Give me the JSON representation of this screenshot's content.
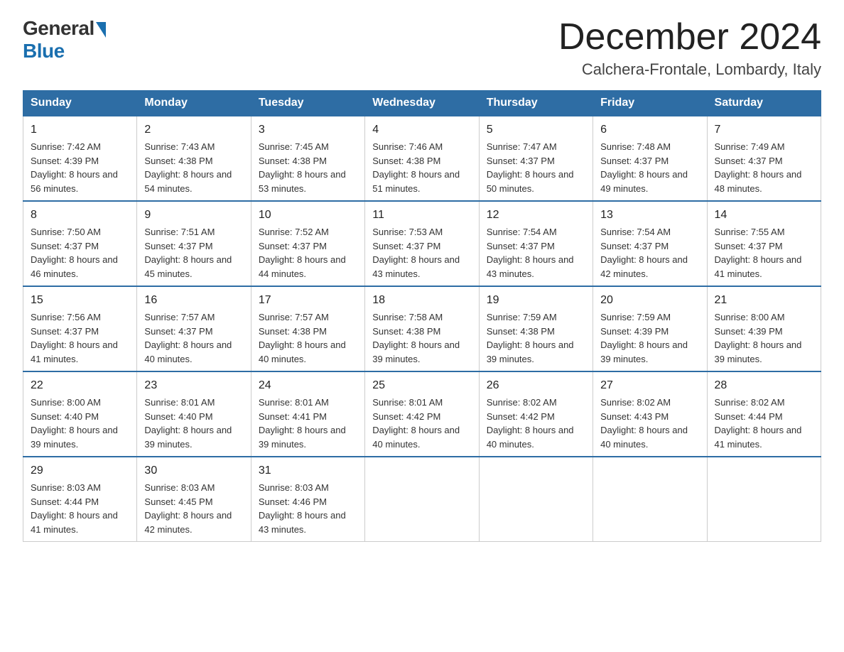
{
  "header": {
    "logo_general": "General",
    "logo_blue": "Blue",
    "title": "December 2024",
    "subtitle": "Calchera-Frontale, Lombardy, Italy"
  },
  "weekdays": [
    "Sunday",
    "Monday",
    "Tuesday",
    "Wednesday",
    "Thursday",
    "Friday",
    "Saturday"
  ],
  "weeks": [
    [
      {
        "day": "1",
        "sunrise": "7:42 AM",
        "sunset": "4:39 PM",
        "daylight": "8 hours and 56 minutes."
      },
      {
        "day": "2",
        "sunrise": "7:43 AM",
        "sunset": "4:38 PM",
        "daylight": "8 hours and 54 minutes."
      },
      {
        "day": "3",
        "sunrise": "7:45 AM",
        "sunset": "4:38 PM",
        "daylight": "8 hours and 53 minutes."
      },
      {
        "day": "4",
        "sunrise": "7:46 AM",
        "sunset": "4:38 PM",
        "daylight": "8 hours and 51 minutes."
      },
      {
        "day": "5",
        "sunrise": "7:47 AM",
        "sunset": "4:37 PM",
        "daylight": "8 hours and 50 minutes."
      },
      {
        "day": "6",
        "sunrise": "7:48 AM",
        "sunset": "4:37 PM",
        "daylight": "8 hours and 49 minutes."
      },
      {
        "day": "7",
        "sunrise": "7:49 AM",
        "sunset": "4:37 PM",
        "daylight": "8 hours and 48 minutes."
      }
    ],
    [
      {
        "day": "8",
        "sunrise": "7:50 AM",
        "sunset": "4:37 PM",
        "daylight": "8 hours and 46 minutes."
      },
      {
        "day": "9",
        "sunrise": "7:51 AM",
        "sunset": "4:37 PM",
        "daylight": "8 hours and 45 minutes."
      },
      {
        "day": "10",
        "sunrise": "7:52 AM",
        "sunset": "4:37 PM",
        "daylight": "8 hours and 44 minutes."
      },
      {
        "day": "11",
        "sunrise": "7:53 AM",
        "sunset": "4:37 PM",
        "daylight": "8 hours and 43 minutes."
      },
      {
        "day": "12",
        "sunrise": "7:54 AM",
        "sunset": "4:37 PM",
        "daylight": "8 hours and 43 minutes."
      },
      {
        "day": "13",
        "sunrise": "7:54 AM",
        "sunset": "4:37 PM",
        "daylight": "8 hours and 42 minutes."
      },
      {
        "day": "14",
        "sunrise": "7:55 AM",
        "sunset": "4:37 PM",
        "daylight": "8 hours and 41 minutes."
      }
    ],
    [
      {
        "day": "15",
        "sunrise": "7:56 AM",
        "sunset": "4:37 PM",
        "daylight": "8 hours and 41 minutes."
      },
      {
        "day": "16",
        "sunrise": "7:57 AM",
        "sunset": "4:37 PM",
        "daylight": "8 hours and 40 minutes."
      },
      {
        "day": "17",
        "sunrise": "7:57 AM",
        "sunset": "4:38 PM",
        "daylight": "8 hours and 40 minutes."
      },
      {
        "day": "18",
        "sunrise": "7:58 AM",
        "sunset": "4:38 PM",
        "daylight": "8 hours and 39 minutes."
      },
      {
        "day": "19",
        "sunrise": "7:59 AM",
        "sunset": "4:38 PM",
        "daylight": "8 hours and 39 minutes."
      },
      {
        "day": "20",
        "sunrise": "7:59 AM",
        "sunset": "4:39 PM",
        "daylight": "8 hours and 39 minutes."
      },
      {
        "day": "21",
        "sunrise": "8:00 AM",
        "sunset": "4:39 PM",
        "daylight": "8 hours and 39 minutes."
      }
    ],
    [
      {
        "day": "22",
        "sunrise": "8:00 AM",
        "sunset": "4:40 PM",
        "daylight": "8 hours and 39 minutes."
      },
      {
        "day": "23",
        "sunrise": "8:01 AM",
        "sunset": "4:40 PM",
        "daylight": "8 hours and 39 minutes."
      },
      {
        "day": "24",
        "sunrise": "8:01 AM",
        "sunset": "4:41 PM",
        "daylight": "8 hours and 39 minutes."
      },
      {
        "day": "25",
        "sunrise": "8:01 AM",
        "sunset": "4:42 PM",
        "daylight": "8 hours and 40 minutes."
      },
      {
        "day": "26",
        "sunrise": "8:02 AM",
        "sunset": "4:42 PM",
        "daylight": "8 hours and 40 minutes."
      },
      {
        "day": "27",
        "sunrise": "8:02 AM",
        "sunset": "4:43 PM",
        "daylight": "8 hours and 40 minutes."
      },
      {
        "day": "28",
        "sunrise": "8:02 AM",
        "sunset": "4:44 PM",
        "daylight": "8 hours and 41 minutes."
      }
    ],
    [
      {
        "day": "29",
        "sunrise": "8:03 AM",
        "sunset": "4:44 PM",
        "daylight": "8 hours and 41 minutes."
      },
      {
        "day": "30",
        "sunrise": "8:03 AM",
        "sunset": "4:45 PM",
        "daylight": "8 hours and 42 minutes."
      },
      {
        "day": "31",
        "sunrise": "8:03 AM",
        "sunset": "4:46 PM",
        "daylight": "8 hours and 43 minutes."
      },
      null,
      null,
      null,
      null
    ]
  ]
}
